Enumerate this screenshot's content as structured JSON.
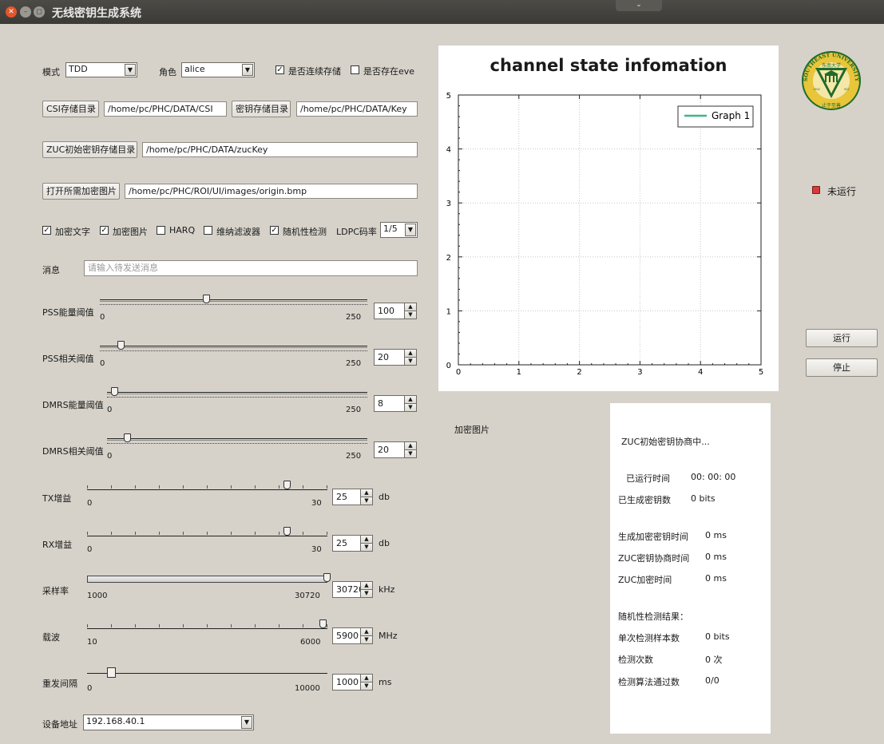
{
  "window": {
    "title": "无线密钥生成系统",
    "close_glyph": "✕",
    "minimize_glyph": "–",
    "maximize_glyph": "◻",
    "menu_glyph": "⌄"
  },
  "config": {
    "mode_label": "模式",
    "mode_value": "TDD",
    "role_label": "角色",
    "role_value": "alice",
    "continuous_save_label": "是否连续存储",
    "continuous_save_checked": true,
    "eve_label": "是否存在eve",
    "eve_checked": false
  },
  "paths": {
    "csi_button": "CSI存储目录",
    "csi_path": "/home/pc/PHC/DATA/CSI",
    "key_button": "密钥存储目录",
    "key_path": "/home/pc/PHC/DATA/Key",
    "zuc_button": "ZUC初始密钥存储目录",
    "zuc_path": "/home/pc/PHC/DATA/zucKey",
    "image_button": "打开所需加密图片",
    "image_path": "/home/pc/PHC/ROI/UI/images/origin.bmp"
  },
  "options": {
    "encrypt_text_label": "加密文字",
    "encrypt_text_checked": true,
    "encrypt_image_label": "加密图片",
    "encrypt_image_checked": true,
    "harq_label": "HARQ",
    "harq_checked": false,
    "wiener_label": "维纳滤波器",
    "wiener_checked": false,
    "randomness_label": "随机性检测",
    "randomness_checked": true,
    "ldpc_label": "LDPC码率",
    "ldpc_value": "1/5"
  },
  "message": {
    "label": "消息",
    "placeholder": "请输入待发送消息"
  },
  "sliders": [
    {
      "label": "PSS能量阈值",
      "min": "0",
      "max": "250",
      "value": "100",
      "fraction": 0.4,
      "unit": ""
    },
    {
      "label": "PSS相关阈值",
      "min": "0",
      "max": "250",
      "value": "20",
      "fraction": 0.08,
      "unit": ""
    },
    {
      "label": "DMRS能量阈值",
      "min": "0",
      "max": "250",
      "value": "8",
      "fraction": 0.032,
      "unit": ""
    },
    {
      "label": "DMRS相关阈值",
      "min": "0",
      "max": "250",
      "value": "20",
      "fraction": 0.08,
      "unit": ""
    },
    {
      "label": "TX增益",
      "min": "0",
      "max": "30",
      "value": "25",
      "fraction": 0.833,
      "unit": "db"
    },
    {
      "label": "RX增益",
      "min": "0",
      "max": "30",
      "value": "25",
      "fraction": 0.833,
      "unit": "db"
    },
    {
      "label": "采样率",
      "min": "1000",
      "max": "30720",
      "value": "30720",
      "fraction": 1.0,
      "unit": "kHz"
    },
    {
      "label": "载波",
      "min": "10",
      "max": "6000",
      "value": "5900",
      "fraction": 0.983,
      "unit": "MHz"
    },
    {
      "label": "重发间隔",
      "min": "0",
      "max": "10000",
      "value": "1000",
      "fraction": 0.1,
      "unit": "ms"
    }
  ],
  "device": {
    "label": "设备地址",
    "value": "192.168.40.1"
  },
  "chart_data": {
    "type": "line",
    "title": "channel state infomation",
    "xlabel": "",
    "ylabel": "",
    "xlim": [
      0,
      5
    ],
    "ylim": [
      0,
      5
    ],
    "x_ticks": [
      "0",
      "1",
      "2",
      "3",
      "4",
      "5"
    ],
    "y_ticks": [
      "0",
      "1",
      "2",
      "3",
      "4",
      "5"
    ],
    "grid": true,
    "legend_position": "top-right",
    "series": [
      {
        "name": "Graph 1",
        "color": "#3cb883",
        "x": [],
        "y": []
      }
    ]
  },
  "image_area": {
    "label": "加密图片"
  },
  "status": {
    "label": "未运行",
    "indicator_color": "#d83a3a"
  },
  "controls": {
    "run_button": "运行",
    "stop_button": "停止"
  },
  "info": {
    "negotiation_status": "ZUC初始密钥协商中...",
    "run_time_label": "已运行时间",
    "run_time_value": "00: 00: 00",
    "generated_key_label": "已生成密钥数",
    "generated_key_value": "0 bits",
    "enc_key_time_label": "生成加密密钥时间",
    "enc_key_time_value": "0 ms",
    "zuc_negotiation_time_label": "ZUC密钥协商时间",
    "zuc_negotiation_time_value": "0 ms",
    "zuc_encrypt_time_label": "ZUC加密时间",
    "zuc_encrypt_time_value": "0 ms",
    "randomness_result_label": "随机性检测结果：",
    "single_sample_label": "单次检测样本数",
    "single_sample_value": "0 bits",
    "test_count_label": "检测次数",
    "test_count_value": "0 次",
    "algorithms_passed_label": "检测算法通过数",
    "algorithms_passed_value": "0/0"
  },
  "logo": {
    "top_text": "SOUTHEAST UNIVERSITY",
    "chinese_name": "东南大学",
    "motto": "止于至善",
    "year_left": "1902",
    "year_right": "902",
    "primary_color": "#1f6b2c",
    "ring_color": "#e9c53a"
  }
}
